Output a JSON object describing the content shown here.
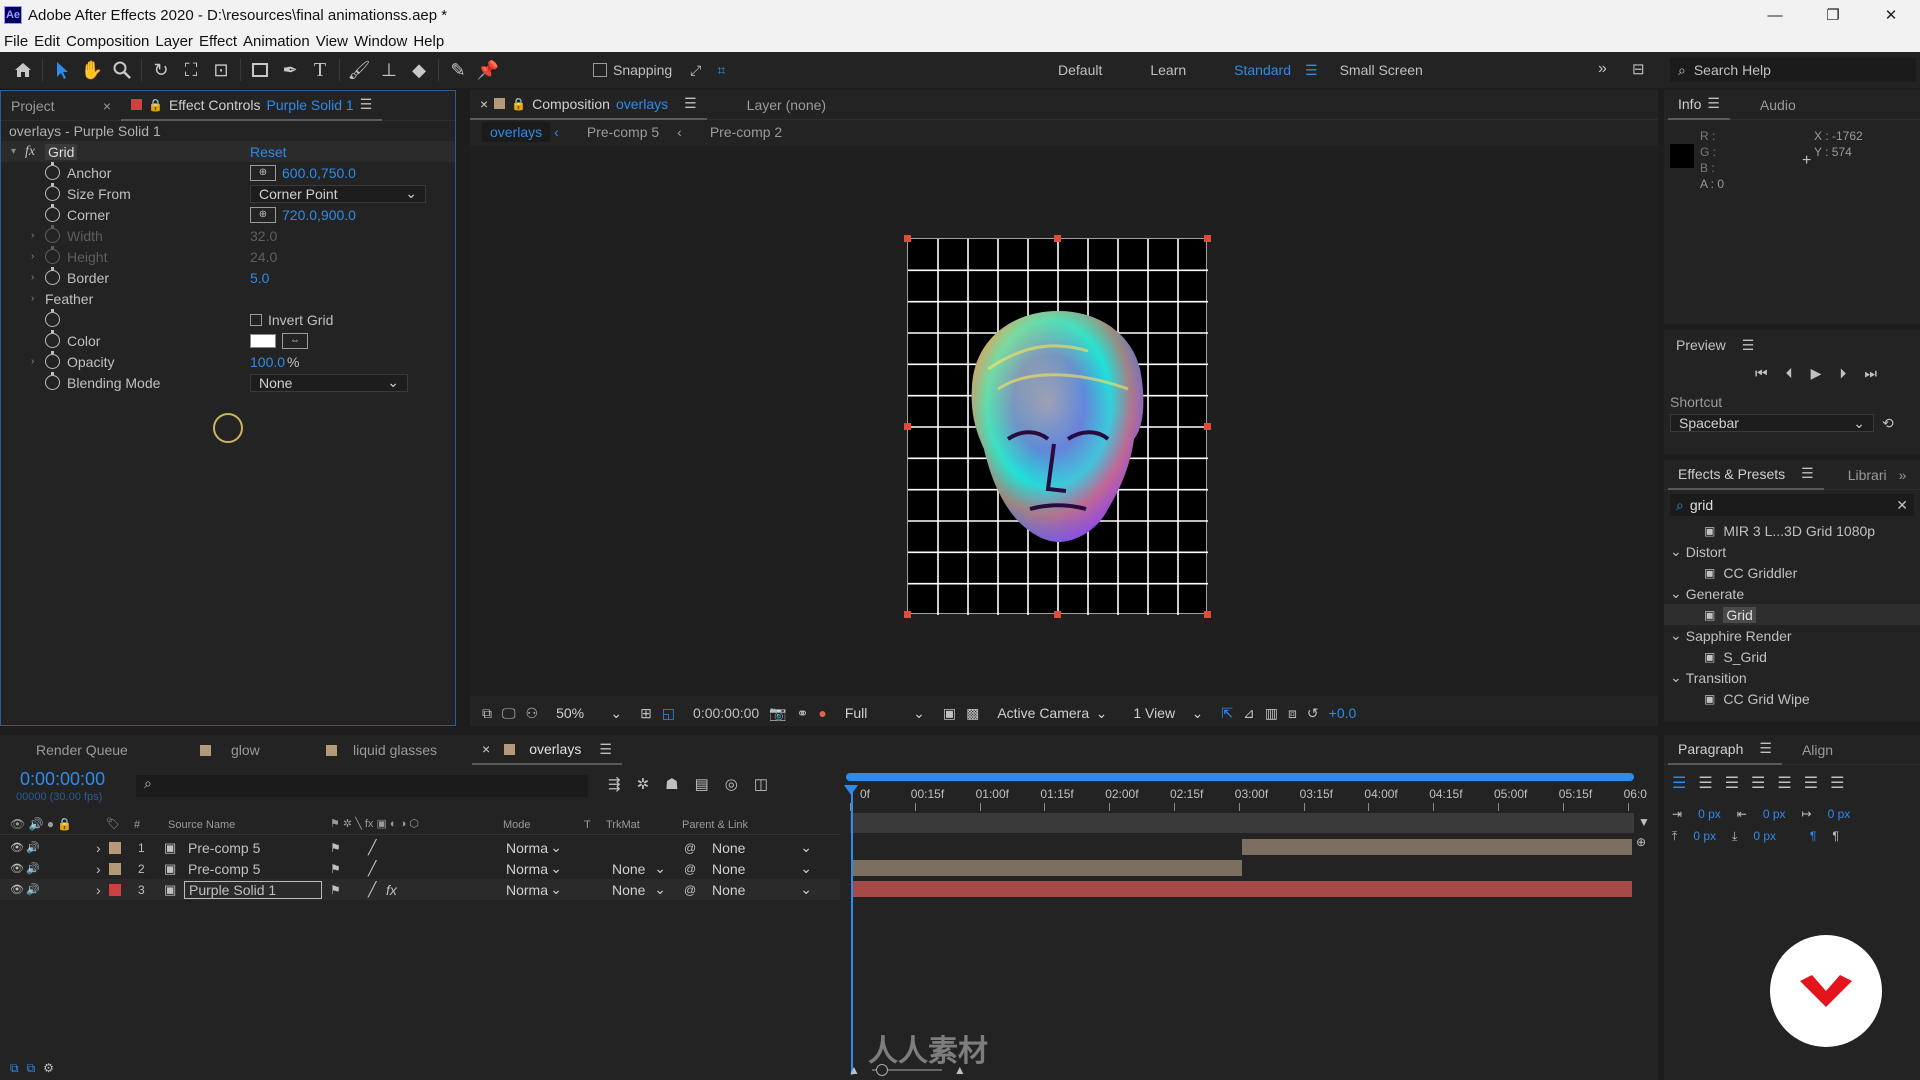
{
  "app": {
    "logo": "Ae",
    "title": "Adobe After Effects 2020 - D:\\resources\\final animationss.aep *"
  },
  "window_controls": [
    "—",
    "❐",
    "✕"
  ],
  "menu": [
    "File",
    "Edit",
    "Composition",
    "Layer",
    "Effect",
    "Animation",
    "View",
    "Window",
    "Help"
  ],
  "toolbar": {
    "tools": [
      "home-icon",
      "selection-icon",
      "hand-icon",
      "zoom-icon",
      "rotate-icon",
      "camera-icon",
      "pan-behind-icon",
      "rectangle-icon",
      "pen-icon",
      "type-icon",
      "brush-icon",
      "clone-stamp-icon",
      "eraser-icon",
      "roto-brush-icon",
      "puppet-icon"
    ],
    "snapping_label": "Snapping",
    "workspaces": [
      "Default",
      "Learn",
      "Standard",
      "Small Screen"
    ],
    "active_workspace": "Standard",
    "search_help": "Search Help"
  },
  "effect_controls": {
    "tab_project": "Project",
    "tab_label": "Effect Controls",
    "tab_layer": "Purple Solid 1",
    "subtitle": "overlays - Purple Solid 1",
    "effect_name": "Grid",
    "reset_label": "Reset",
    "props": [
      {
        "name": "Anchor",
        "value": "600.0,750.0"
      },
      {
        "name": "Size From",
        "value": "Corner Point"
      },
      {
        "name": "Corner",
        "value": "720.0,900.0"
      },
      {
        "name": "Width",
        "value": "32.0"
      },
      {
        "name": "Height",
        "value": "24.0"
      },
      {
        "name": "Border",
        "value": "5.0"
      },
      {
        "name": "Feather",
        "value": ""
      },
      {
        "name": "",
        "value": "Invert Grid"
      },
      {
        "name": "Color",
        "value": ""
      },
      {
        "name": "Opacity",
        "value": "100.0",
        "unit": "%"
      },
      {
        "name": "Blending Mode",
        "value": "None"
      }
    ]
  },
  "composition": {
    "tab_label": "Composition",
    "tab_name": "overlays",
    "layer_tab": "Layer  (none)",
    "flow": [
      "overlays",
      "Pre-comp 5",
      "Pre-comp 2"
    ],
    "zoom": "50%",
    "timecode": "0:00:00:00",
    "resolution": "Full",
    "camera": "Active Camera",
    "views": "1 View",
    "exposure": "+0.0",
    "grid_cols": 10,
    "grid_rows": 12
  },
  "info": {
    "tab_info": "Info",
    "tab_audio": "Audio",
    "r": "R :",
    "g": "G :",
    "b": "B :",
    "a": "A :  0",
    "x": "X : -1762",
    "y": "Y : 574"
  },
  "preview": {
    "title": "Preview",
    "shortcut_label": "Shortcut",
    "shortcut_value": "Spacebar"
  },
  "effects_presets": {
    "tab": "Effects & Presets",
    "tab2": "Librari",
    "search": "grid",
    "items": [
      {
        "type": "item",
        "label": "MIR 3 L...3D Grid 1080p"
      },
      {
        "type": "group",
        "label": "Distort"
      },
      {
        "type": "item",
        "label": "CC Griddler"
      },
      {
        "type": "group",
        "label": "Generate"
      },
      {
        "type": "item",
        "label": "Grid",
        "selected": true
      },
      {
        "type": "group",
        "label": "Sapphire Render"
      },
      {
        "type": "item",
        "label": "S_Grid"
      },
      {
        "type": "group",
        "label": "Transition"
      },
      {
        "type": "item",
        "label": "CC Grid Wipe"
      }
    ]
  },
  "paragraph": {
    "tab": "Paragraph",
    "tab2": "Align",
    "indent": [
      "0 px",
      "0 px",
      "0 px",
      "0 px",
      "0 px"
    ]
  },
  "timeline": {
    "tabs": [
      "Render Queue",
      "glow",
      "liquid glasses",
      "overlays"
    ],
    "active_tab": "overlays",
    "timecode": "0:00:00:00",
    "fps": "00000 (30.00 fps)",
    "columns": {
      "num": "#",
      "source": "Source Name",
      "mode": "Mode",
      "t": "T",
      "trkmat": "TrkMat",
      "parent": "Parent & Link"
    },
    "ruler": [
      "0f",
      "00:15f",
      "01:00f",
      "01:15f",
      "02:00f",
      "02:15f",
      "03:00f",
      "03:15f",
      "04:00f",
      "04:15f",
      "05:00f",
      "05:15f",
      "06:0"
    ],
    "layers": [
      {
        "num": "1",
        "name": "Pre-comp 5",
        "mode": "Norma",
        "trkmat": "",
        "parent": "None",
        "color": "#b59a7a",
        "bar_start": 0.5,
        "bar_end": 1.0,
        "bar_color": "#7d6f5f"
      },
      {
        "num": "2",
        "name": "Pre-comp 5",
        "mode": "Norma",
        "trkmat": "None",
        "parent": "None",
        "color": "#b59a7a",
        "bar_start": 0.0,
        "bar_end": 0.5,
        "bar_color": "#7d6f5f"
      },
      {
        "num": "3",
        "name": "Purple Solid 1",
        "mode": "Norma",
        "trkmat": "None",
        "parent": "None",
        "color": "#d14040",
        "bar_start": 0.0,
        "bar_end": 1.0,
        "bar_color": "#a54a46"
      }
    ]
  },
  "watermark": "人人素材"
}
